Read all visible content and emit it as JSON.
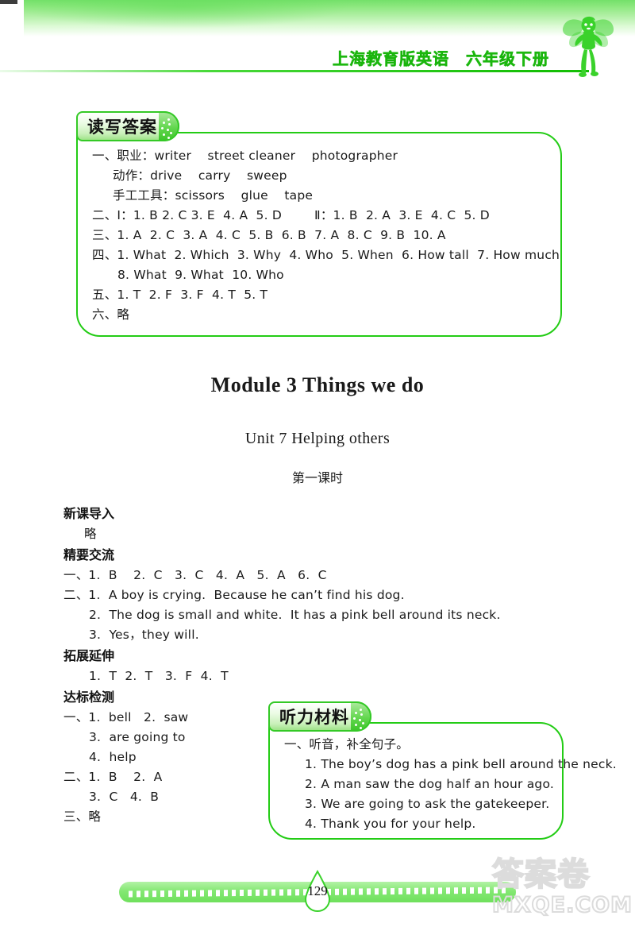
{
  "header": {
    "title": "上海教育版英语　六年级下册",
    "mascot_icon": "fairy-icon"
  },
  "read_write_box": {
    "tab_label": "读写答案",
    "lines": [
      {
        "text": "一、职业：writer    street cleaner    photographer",
        "indent": 0
      },
      {
        "text": "动作：drive    carry    sweep",
        "indent": 1
      },
      {
        "text": "手工工具：scissors    glue    tape",
        "indent": 1
      },
      {
        "text": "二、Ⅰ：1. B 2. C 3. E  4. A  5. D        Ⅱ：1. B  2. A  3. E  4. C  5. D",
        "indent": 0
      },
      {
        "text": "三、1. A  2. C  3. A  4. C  5. B  6. B  7. A  8. C  9. B  10. A",
        "indent": 0
      },
      {
        "text": "四、1. What  2. Which  3. Why  4. Who  5. When  6. How tall  7. How much",
        "indent": 0
      },
      {
        "text": "8. What  9. What  10. Who",
        "indent": 2
      },
      {
        "text": "五、1. T  2. F  3. F  4. T  5. T",
        "indent": 0
      },
      {
        "text": "六、略",
        "indent": 0
      }
    ]
  },
  "module_title": "Module 3  Things we do",
  "unit_title": "Unit 7 Helping others",
  "period_title": "第一课时",
  "sections": [
    {
      "heading": "新课导入",
      "lines": [
        {
          "text": "略",
          "indent": 1
        }
      ]
    },
    {
      "heading": "精要交流",
      "lines": [
        {
          "text": "一、1.  B    2.  C   3.  C   4.  A   5.  A   6.  C",
          "indent": 0
        },
        {
          "text": "二、1.  A boy is crying.  Because he can’t find his dog.",
          "indent": 0
        },
        {
          "text": "2.  The dog is small and white.  It has a pink bell around its neck.",
          "indent": 2
        },
        {
          "text": "3.  Yes，they will.",
          "indent": 2
        }
      ]
    },
    {
      "heading": "拓展延伸",
      "lines": [
        {
          "text": "1.  T  2.  T   3.  F  4.  T",
          "indent": 2
        }
      ]
    },
    {
      "heading": "达标检测",
      "lines": [
        {
          "text": "一、1.  bell   2.  saw",
          "indent": 0
        },
        {
          "text": "3.  are going to",
          "indent": 2
        },
        {
          "text": "4.  help",
          "indent": 2
        },
        {
          "text": "二、1.  B    2.  A",
          "indent": 0
        },
        {
          "text": "3.  C   4.  B",
          "indent": 2
        },
        {
          "text": "三、略",
          "indent": 0
        }
      ]
    }
  ],
  "listening_box": {
    "tab_label": "听力材料",
    "lines": [
      {
        "text": "一、听音，补全句子。",
        "indent": 0
      },
      {
        "text": "1. The boy’s dog has a pink bell around the neck.",
        "indent": 1
      },
      {
        "text": "2. A man saw the dog half an hour ago.",
        "indent": 1
      },
      {
        "text": "3. We are going to ask the gatekeeper.",
        "indent": 1
      },
      {
        "text": "4. Thank you for your help.",
        "indent": 1
      }
    ]
  },
  "footer": {
    "page_number": "129"
  },
  "watermark": {
    "cn_text": "答案卷",
    "en_text": "MXQE.COM"
  },
  "colors": {
    "accent_green": "#23cc15",
    "band_green": "#74e06a",
    "title_green": "#2fd21f",
    "watermark_gray": "#dcdcdc"
  }
}
